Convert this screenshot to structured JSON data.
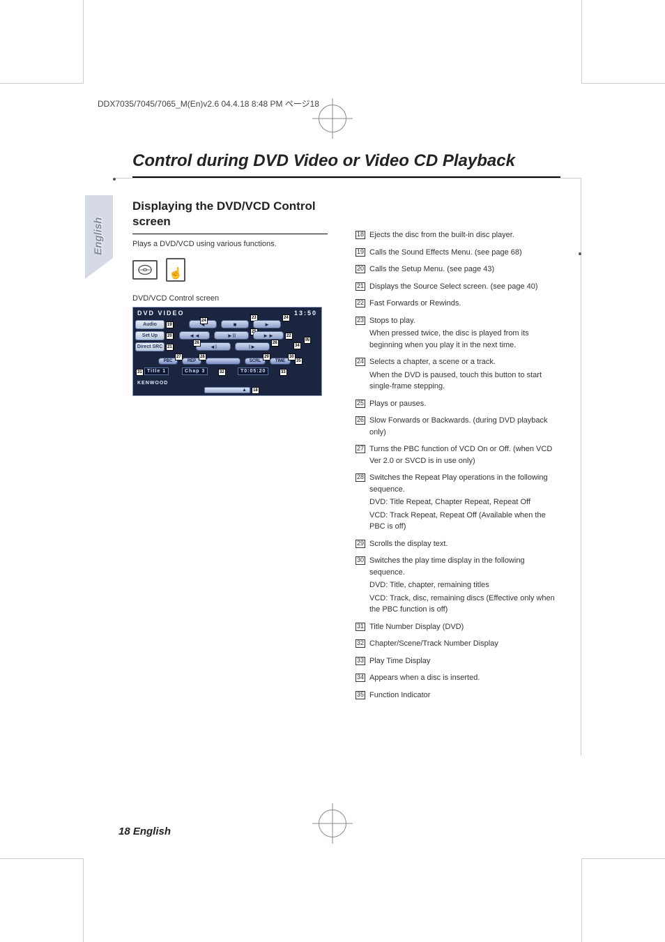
{
  "header": "DDX7035/7045/7065_M(En)v2.6  04.4.18  8:48 PM  ページ18",
  "pageTitle": "Control during DVD Video or Video CD Playback",
  "langTab": "English",
  "section": {
    "title": "Displaying the DVD/VCD Control screen",
    "intro": "Plays a DVD/VCD using various functions.",
    "screenLabel": "DVD/VCD Control screen"
  },
  "screen": {
    "mode": "DVD VIDEO",
    "clock": "13:50",
    "sideButtons": {
      "audio": "Audio",
      "setup": "Set Up",
      "direct": "Direct SRC"
    },
    "pills": {
      "pbc": "PBC",
      "rep": "REP",
      "srch": "SCRL",
      "time": "TIME"
    },
    "info": {
      "title": "Title 1",
      "chap": "Chap  3",
      "time": "T0:05:20"
    },
    "brand": "KENWOOD",
    "callouts": {
      "n18": "18",
      "n19": "19",
      "n20": "20",
      "n21": "21",
      "n22": "22",
      "n23": "23",
      "n24": "24",
      "n25": "25",
      "n26": "26",
      "n27": "27",
      "n28": "28",
      "n29": "29",
      "n30": "30",
      "n31": "31",
      "n32": "32",
      "n33": "33",
      "n34": "34",
      "n35": "35"
    }
  },
  "descriptions": [
    {
      "num": "18",
      "text": "Ejects the disc from the built-in disc player."
    },
    {
      "num": "19",
      "text": "Calls the Sound Effects Menu. (see page 68)"
    },
    {
      "num": "20",
      "text": "Calls the Setup Menu. (see page 43)"
    },
    {
      "num": "21",
      "text": "Displays the Source Select screen. (see page 40)"
    },
    {
      "num": "22",
      "text": "Fast Forwards or Rewinds."
    },
    {
      "num": "23",
      "text": "Stops to play.",
      "sub": "When pressed twice, the disc is played from its beginning when you play it in the next time."
    },
    {
      "num": "24",
      "text": "Selects a chapter, a scene or a track.",
      "sub": "When the DVD is paused, touch this button to start single-frame stepping."
    },
    {
      "num": "25",
      "text": "Plays or pauses."
    },
    {
      "num": "26",
      "text": "Slow Forwards or Backwards. (during DVD playback only)"
    },
    {
      "num": "27",
      "text": "Turns the PBC function of VCD On or Off. (when VCD Ver 2.0 or SVCD is in use only)"
    },
    {
      "num": "28",
      "text": "Switches the Repeat Play operations in the following sequence.",
      "sub": "DVD: Title Repeat, Chapter Repeat, Repeat Off\nVCD: Track Repeat, Repeat Off (Available when the PBC is off)"
    },
    {
      "num": "29",
      "text": "Scrolls the display text."
    },
    {
      "num": "30",
      "text": "Switches the play time display in the following sequence.",
      "sub": "DVD: Title, chapter, remaining titles\nVCD: Track, disc, remaining discs (Effective only when the PBC function is off)"
    },
    {
      "num": "31",
      "text": "Title Number Display (DVD)"
    },
    {
      "num": "32",
      "text": "Chapter/Scene/Track Number Display"
    },
    {
      "num": "33",
      "text": "Play Time Display"
    },
    {
      "num": "34",
      "text": "Appears when a disc is inserted."
    },
    {
      "num": "35",
      "text": "Function Indicator"
    }
  ],
  "footer": "18 English"
}
